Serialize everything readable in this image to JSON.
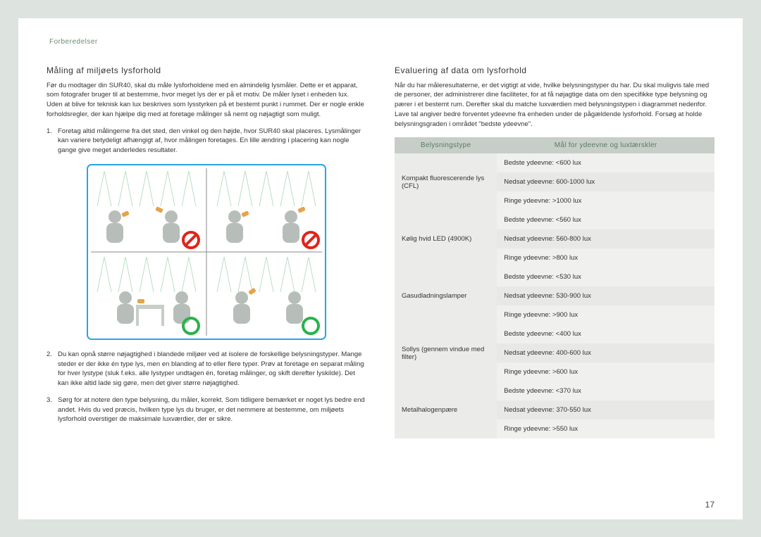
{
  "breadcrumb": "Forberedelser",
  "pageNumber": "17",
  "left": {
    "heading": "Måling af miljøets lysforhold",
    "intro": "Før du modtager din SUR40, skal du måle lysforholdene med en almindelig lysmåler. Dette er et apparat, som fotografer bruger til at bestemme, hvor meget lys der er på et motiv. De måler lyset i enheden lux. Uden at blive for teknisk kan lux beskrives som lysstyrken på et bestemt punkt i rummet. Der er nogle enkle forholdsregler, der kan hjælpe dig med at foretage målinger så nemt og nøjagtigt som muligt.",
    "items": [
      "Foretag altid målingerne fra det sted, den vinkel og den højde, hvor SUR40 skal placeres. Lysmålinger kan variere betydeligt afhængigt af, hvor målingen foretages. En lille ændring i placering kan nogle gange give meget anderledes resultater.",
      "Du kan opnå større nøjagtighed i blandede miljøer ved at isolere de forskellige belysningstyper. Mange steder er der ikke én type lys, men en blanding af to eller flere typer. Prøv at foretage en separat måling for hver lystype (sluk f.eks. alle lystyper undtagen én, foretag målinger, og skift derefter lyskilde). Det kan ikke altid lade sig gøre, men det giver større nøjagtighed.",
      "Sørg for at notere den type belysning, du måler, korrekt. Som tidligere bemærket er noget lys bedre end andet. Hvis du ved præcis, hvilken type lys du bruger, er det nemmere at bestemme, om miljøets lysforhold overstiger de maksimale luxværdier, der er sikre."
    ]
  },
  "right": {
    "heading": "Evaluering af data om lysforhold",
    "para": "Når du har måleresultaterne, er det vigtigt at vide, hvilke belysningstyper du har. Du skal muligvis tale med de personer, der administrerer dine faciliteter, for at få nøjagtige data om den specifikke type belysning og pærer i et bestemt rum. Derefter skal du matche luxværdien med belysningstypen i diagrammet nedenfor. Lave tal angiver bedre forventet ydeevne fra enheden under de pågældende lysforhold. Forsøg at holde belysningsgraden i området \"bedste ydeevne\".",
    "table": {
      "headers": [
        "Belysningstype",
        "Mål for ydeevne og luxtærskler"
      ],
      "rows": [
        {
          "type": "Kompakt fluorescerende lys (CFL)",
          "best": "Bedste ydeevne: <600 lux",
          "reduced": "Nedsat ydeevne: 600-1000 lux",
          "poor": "Ringe ydeevne: >1000 lux"
        },
        {
          "type": "Kølig hvid LED (4900K)",
          "best": "Bedste ydeevne: <560 lux",
          "reduced": "Nedsat ydeevne: 560-800 lux",
          "poor": "Ringe ydeevne: >800 lux"
        },
        {
          "type": "Gasudladningslamper",
          "best": "Bedste ydeevne: <530 lux",
          "reduced": "Nedsat ydeevne: 530-900 lux",
          "poor": "Ringe ydeevne: >900 lux"
        },
        {
          "type": "Sollys (gennem vindue med filter)",
          "best": "Bedste ydeevne: <400 lux",
          "reduced": "Nedsat ydeevne: 400-600 lux",
          "poor": "Ringe ydeevne: >600 lux"
        },
        {
          "type": "Metalhalogenpære",
          "best": "Bedste ydeevne: <370 lux",
          "reduced": "Nedsat ydeevne: 370-550 lux",
          "poor": "Ringe ydeevne: >550 lux"
        }
      ]
    }
  }
}
